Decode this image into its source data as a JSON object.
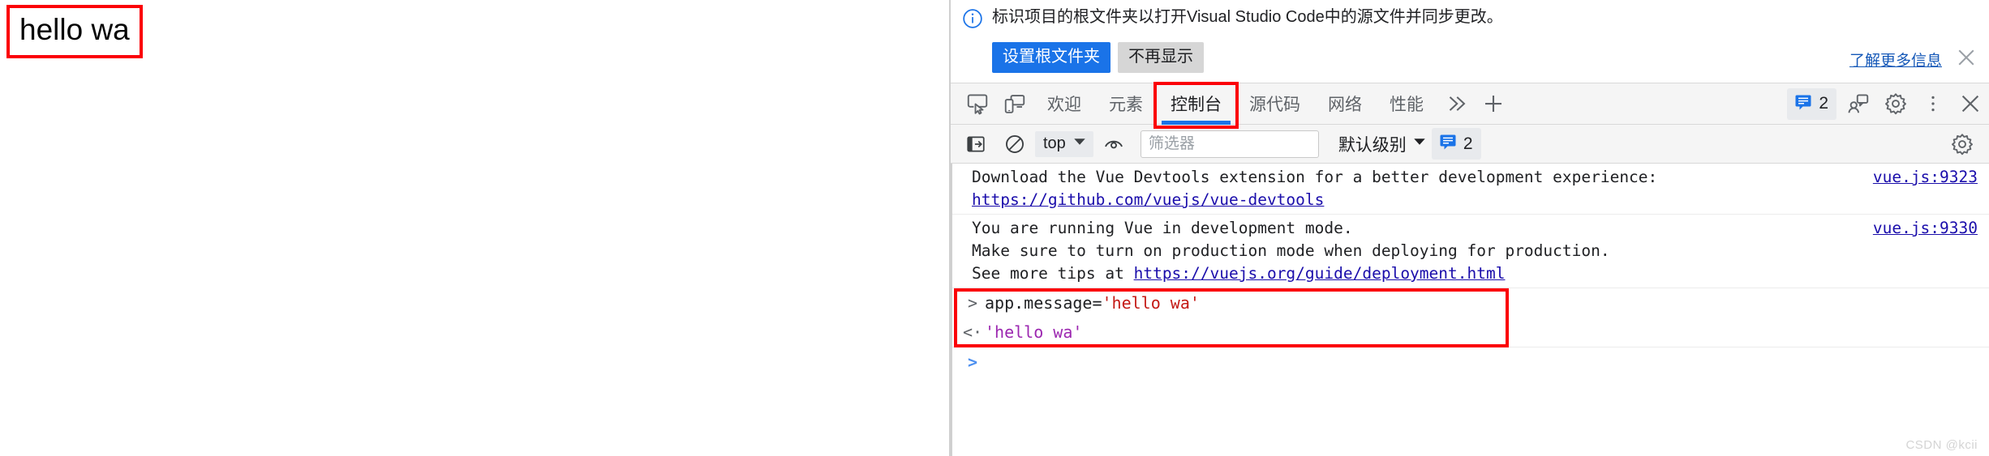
{
  "page": {
    "hello_text": "hello wa"
  },
  "devtools": {
    "info_banner": {
      "icon": "info-circle-icon",
      "message": "标识项目的根文件夹以打开Visual Studio Code中的源文件并同步更改。",
      "primary_button": "设置根文件夹",
      "secondary_button": "不再显示",
      "learn_more": "了解更多信息",
      "close_icon": "close-icon"
    },
    "tabstrip": {
      "left_icons": [
        "inspect-element-icon",
        "device-toolbar-icon"
      ],
      "tabs": [
        {
          "label": "欢迎",
          "active": false
        },
        {
          "label": "元素",
          "active": false
        },
        {
          "label": "控制台",
          "active": true
        },
        {
          "label": "源代码",
          "active": false
        },
        {
          "label": "网络",
          "active": false
        },
        {
          "label": "性能",
          "active": false
        }
      ],
      "overflow_icon": "chevron-double-right-icon",
      "add_icon": "plus-icon",
      "message_badge_icon": "console-message-icon",
      "message_badge_count": "2",
      "feedback_icon": "feedback-icon",
      "settings_icon": "gear-icon",
      "more_icon": "kebab-menu-icon",
      "close_icon": "close-icon"
    },
    "console_toolbar": {
      "sidebar_icon": "console-sidebar-icon",
      "clear_icon": "clear-console-icon",
      "context_value": "top",
      "context_chevron": "chevron-down-icon",
      "eye_icon": "live-expression-icon",
      "filter_placeholder": "筛选器",
      "filter_value": "",
      "level_label": "默认级别",
      "level_chevron": "chevron-down-icon",
      "issues_icon": "console-message-icon",
      "issues_count": "2",
      "settings_icon": "gear-icon"
    },
    "console_messages": [
      {
        "lines": [
          {
            "text": "Download the Vue Devtools extension for a better development experience:",
            "link": false
          },
          {
            "text": "https://github.com/vuejs/vue-devtools",
            "link": true
          }
        ],
        "source": "vue.js:9323"
      },
      {
        "lines": [
          {
            "text": "You are running Vue in development mode.",
            "link": false
          },
          {
            "text": "Make sure to turn on production mode when deploying for production.",
            "link": false
          },
          {
            "text": "See more tips at ",
            "link": false,
            "trailing_link": "https://vuejs.org/guide/deployment.html"
          }
        ],
        "source": "vue.js:9330"
      }
    ],
    "console_eval": {
      "input_arrow": ">",
      "input_code_prefix": "app.message=",
      "input_code_string": "'hello wa'",
      "output_arrow": "<·",
      "output_value": "'hello wa'",
      "prompt_arrow": ">"
    },
    "watermark": "CSDN @kcii",
    "colors": {
      "accent_blue": "#1a73e8",
      "annotation_red": "#fb0007",
      "link_blue": "#1a0dab",
      "string_red": "#c41a16",
      "string_purple": "#9c27b0"
    }
  }
}
